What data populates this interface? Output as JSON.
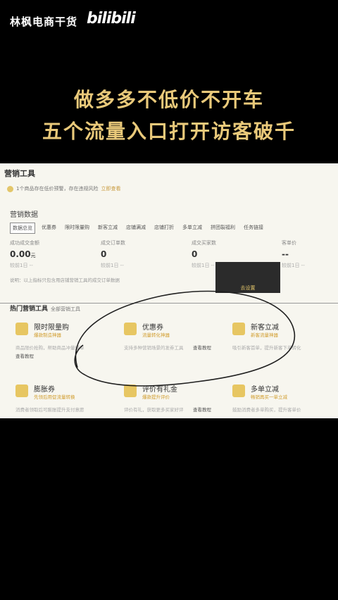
{
  "brand": {
    "name": "林枫电商干货",
    "logo": "bilibili"
  },
  "headline": {
    "line1": "做多多不低价不开车",
    "line2": "五个流量入口打开访客破千"
  },
  "panel": {
    "title": "营销工具",
    "notice": {
      "text": "1个商品存在低价预警，存在违规风险",
      "link": "立即查看"
    },
    "section": "营销数据",
    "tabs": [
      "数据总览",
      "优惠券",
      "限时限量购",
      "新客立减",
      "店铺满减",
      "店铺打折",
      "多单立减",
      "拼团裂福利",
      "任务链接"
    ],
    "metrics": [
      {
        "label": "成功成交金额",
        "value": "0.00",
        "unit": "元",
        "sub": "较前1日 --"
      },
      {
        "label": "成交订单数",
        "value": "0",
        "unit": "",
        "sub": "较前1日 --"
      },
      {
        "label": "成交买家数",
        "value": "0",
        "unit": "",
        "sub": "较前1日 --"
      },
      {
        "label": "客单价",
        "value": "--",
        "unit": "",
        "sub": "较前1日 --"
      }
    ],
    "note": "说明：以上指标只包含用店铺营销工具的成交订单数据",
    "dark_button": "去设置",
    "hot": {
      "title": "热门营销工具",
      "all": "全部营销工具"
    },
    "tools": [
      {
        "title": "限时限量购",
        "subtitle": "爆款制造神器",
        "desc": "商品限价抢购，帮助商品冲量爆单",
        "more": "查看教程"
      },
      {
        "title": "优惠券",
        "subtitle": "流量转化神器",
        "desc": "支持多种营销场景的发券工具",
        "more": "查看教程"
      },
      {
        "title": "新客立减",
        "subtitle": "新客流量神器",
        "desc": "吸引新客首单，提升新客下单转化",
        "more": ""
      },
      {
        "title": "膨胀券",
        "subtitle": "先领后用促流量转换",
        "desc": "消费者领取后可膨胀提升支付意愿",
        "more": ""
      },
      {
        "title": "评价有礼金",
        "subtitle": "爆款提升评价",
        "desc": "评价有礼，获取更多买家好评",
        "more": "查看教程"
      },
      {
        "title": "多单立减",
        "subtitle": "畅销再买一单立减",
        "desc": "鼓励消费者多单购买，提升客单价",
        "more": ""
      }
    ]
  },
  "colors": {
    "gold": "#e9c97a",
    "accent": "#d19d2e",
    "panel_bg": "#f7f6ef"
  }
}
